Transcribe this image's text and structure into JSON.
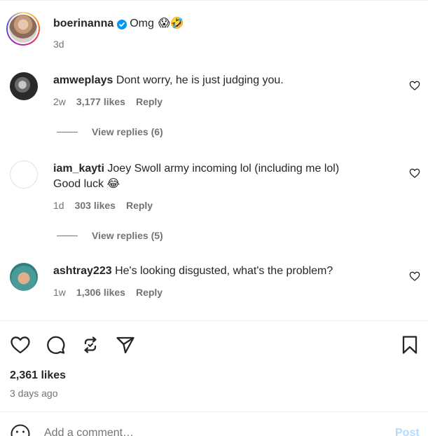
{
  "caption": {
    "username": "boerinanna",
    "text": "Omg",
    "emojis": "😱🤣",
    "time": "3d",
    "verified_icon": "verified-badge-icon"
  },
  "comments": [
    {
      "username": "amweplays",
      "text": "Dont worry, he is just judging you.",
      "time": "2w",
      "likes": "3,177 likes",
      "reply": "Reply",
      "view_replies": "View replies (6)"
    },
    {
      "username": "iam_kayti",
      "text": "Joey Swoll army incoming lol (including me lol)",
      "text2": "Good luck 😂",
      "time": "1d",
      "likes": "303 likes",
      "reply": "Reply",
      "view_replies": "View replies (5)"
    },
    {
      "username": "ashtray223",
      "text": "He's looking disgusted, what's the problem?",
      "time": "1w",
      "likes": "1,306 likes",
      "reply": "Reply"
    }
  ],
  "post": {
    "likes": "2,361 likes",
    "date": "3 days ago"
  },
  "comment_box": {
    "placeholder": "Add a comment…",
    "post_label": "Post"
  },
  "colors": {
    "text": "#262626",
    "secondary": "#737373",
    "divider": "#efefef",
    "verified": "#0095f6",
    "post_button": "#b3dbff"
  },
  "icons": [
    "heart-icon",
    "comment-icon",
    "repost-icon",
    "share-icon",
    "bookmark-icon",
    "emoji-icon"
  ]
}
